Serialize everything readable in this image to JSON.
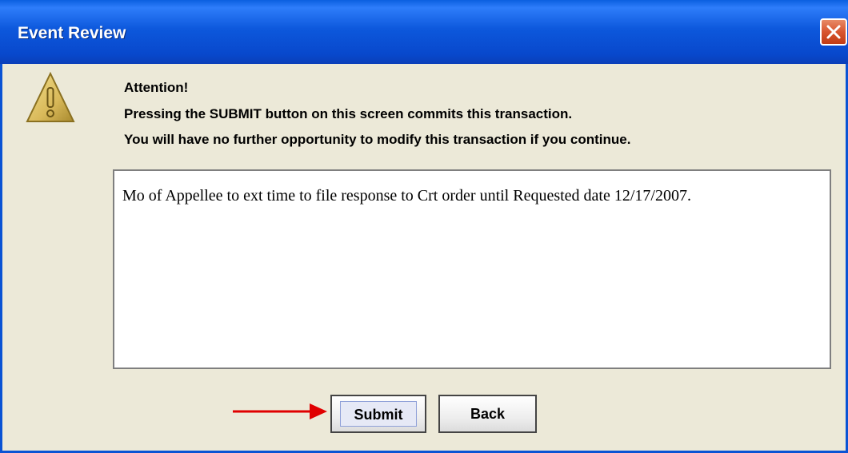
{
  "window": {
    "title": "Event Review"
  },
  "dialog": {
    "icon": "warning-icon",
    "message_lines": [
      "Attention!",
      "Pressing the SUBMIT button on this screen commits this transaction.",
      "You will have no further opportunity to modify this transaction if you continue."
    ],
    "docket_text": "Mo of Appellee to ext time to file response to Crt order until Requested date 12/17/2007."
  },
  "buttons": {
    "submit_label": "Submit",
    "back_label": "Back"
  },
  "annotation": {
    "arrow_color": "#e00000"
  },
  "colors": {
    "titlebar": "#0a53d4",
    "close": "#d8552e",
    "dialog_bg": "#ece9d8"
  }
}
